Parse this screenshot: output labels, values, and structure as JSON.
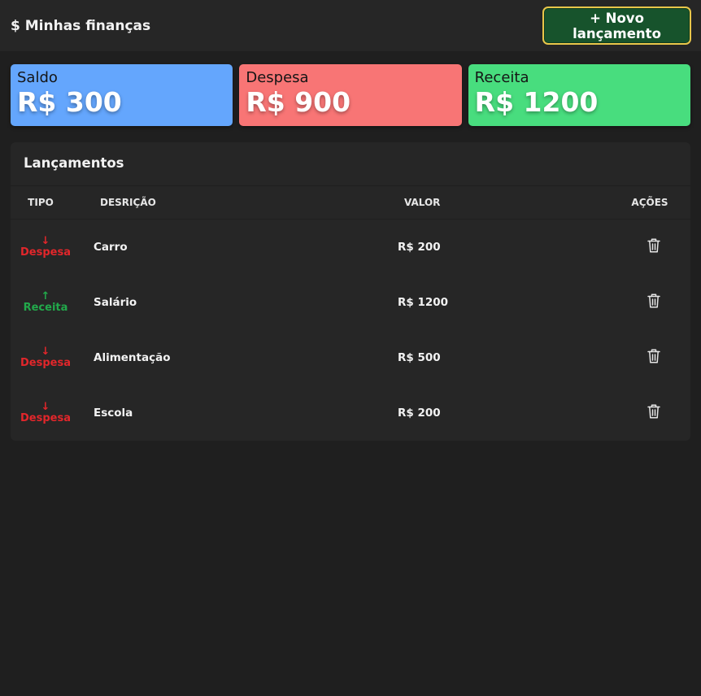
{
  "app": {
    "title": "$ Minhas finanças",
    "new_button": "+ Novo lançamento"
  },
  "colors": {
    "saldo": "#64a6fd",
    "despesa": "#f87575",
    "receita": "#48dd7e",
    "button_bg": "#17532c",
    "button_border": "#e8c64a",
    "despesa_text": "#e2262b",
    "receita_text": "#22a94b"
  },
  "cards": [
    {
      "label": "Saldo",
      "value": "R$ 300"
    },
    {
      "label": "Despesa",
      "value": "R$ 900"
    },
    {
      "label": "Receita",
      "value": "R$ 1200"
    }
  ],
  "table": {
    "title": "Lançamentos",
    "headers": {
      "tipo": "TIPO",
      "descricao": "DESRIÇÃO",
      "valor": "VALOR",
      "acoes": "AÇÕES"
    },
    "rows": [
      {
        "tipo": "Despesa",
        "arrow": "↓",
        "descricao": "Carro",
        "valor": "R$ 200",
        "action_icon": "trash-icon"
      },
      {
        "tipo": "Receita",
        "arrow": "↑",
        "descricao": "Salário",
        "valor": "R$ 1200",
        "action_icon": "trash-icon"
      },
      {
        "tipo": "Despesa",
        "arrow": "↓",
        "descricao": "Alimentação",
        "valor": "R$ 500",
        "action_icon": "trash-icon"
      },
      {
        "tipo": "Despesa",
        "arrow": "↓",
        "descricao": "Escola",
        "valor": "R$ 200",
        "action_icon": "trash-icon"
      }
    ]
  }
}
